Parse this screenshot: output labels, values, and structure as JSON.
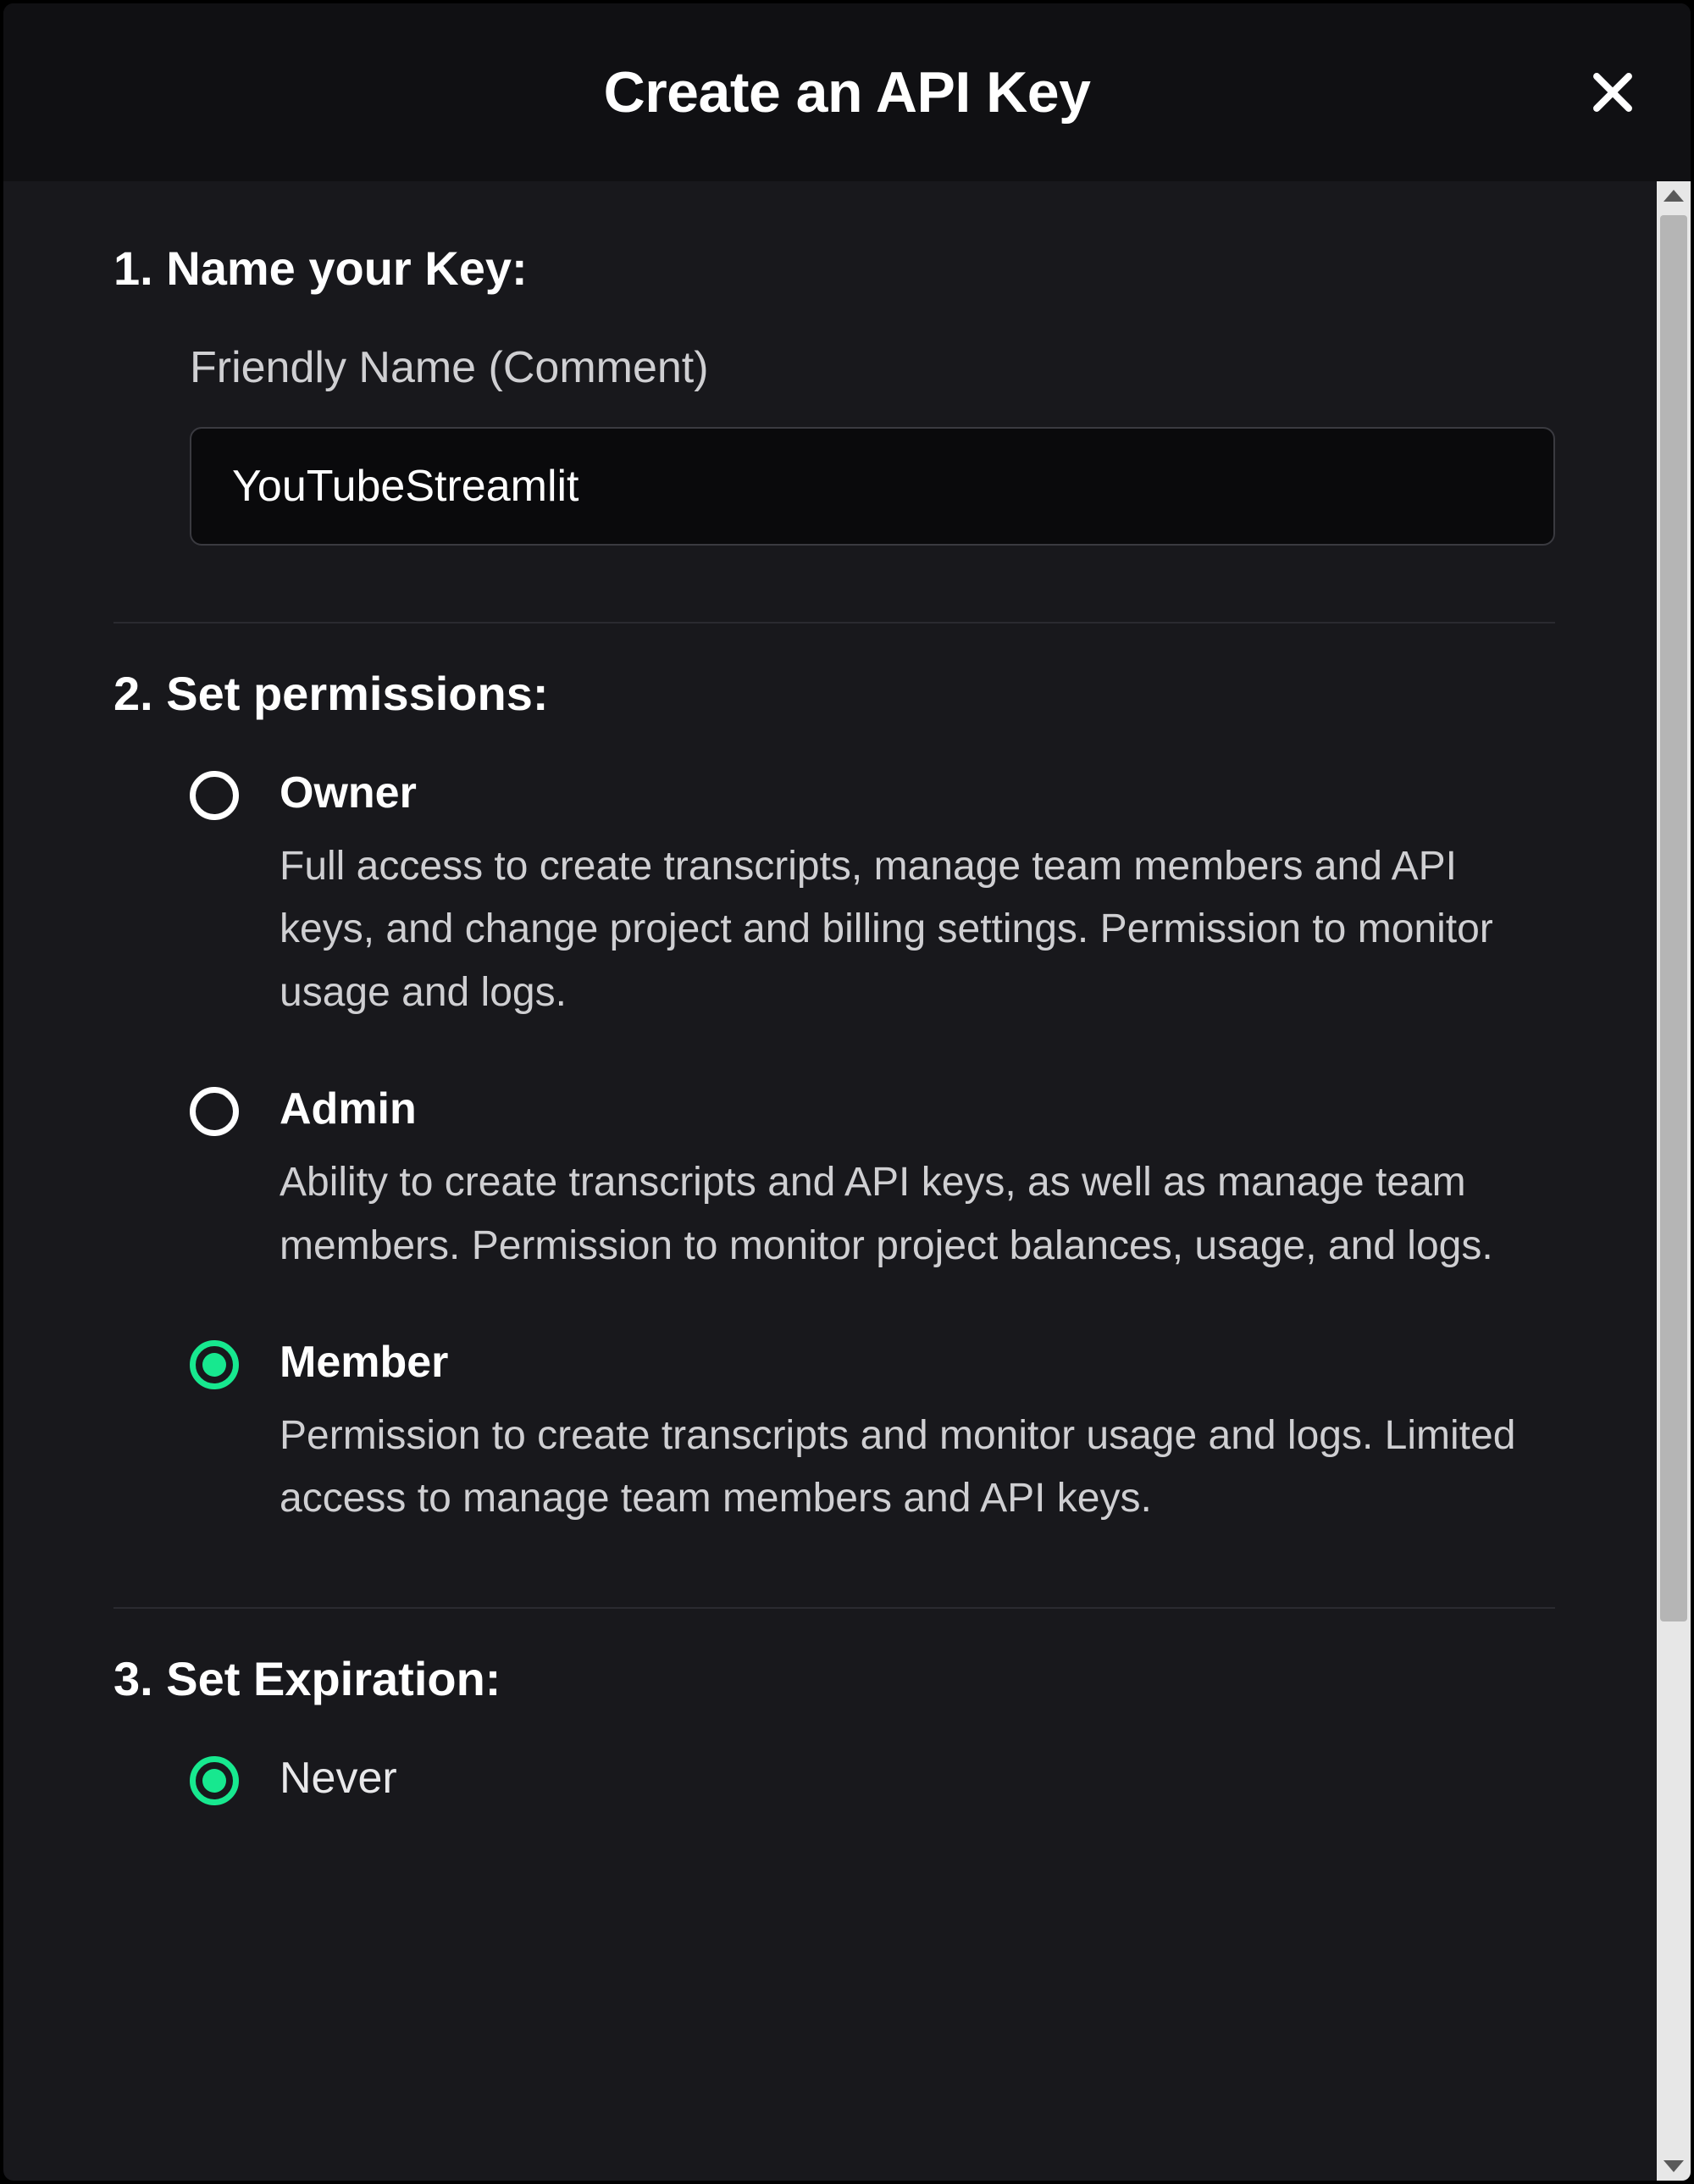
{
  "modal": {
    "title": "Create an API Key"
  },
  "section1": {
    "heading": "1. Name your Key:",
    "field_label": "Friendly Name (Comment)",
    "value": "YouTubeStreamlit"
  },
  "section2": {
    "heading": "2. Set permissions:",
    "options": [
      {
        "title": "Owner",
        "desc": "Full access to create transcripts, manage team members and API keys, and change project and billing settings. Permission to monitor usage and logs.",
        "selected": false
      },
      {
        "title": "Admin",
        "desc": "Ability to create transcripts and API keys, as well as manage team members. Permission to monitor project balances, usage, and logs.",
        "selected": false
      },
      {
        "title": "Member",
        "desc": "Permission to create transcripts and monitor usage and logs. Limited access to manage team members and API keys.",
        "selected": true
      }
    ]
  },
  "section3": {
    "heading": "3. Set Expiration:",
    "options": [
      {
        "title": "Never",
        "selected": true
      }
    ]
  }
}
